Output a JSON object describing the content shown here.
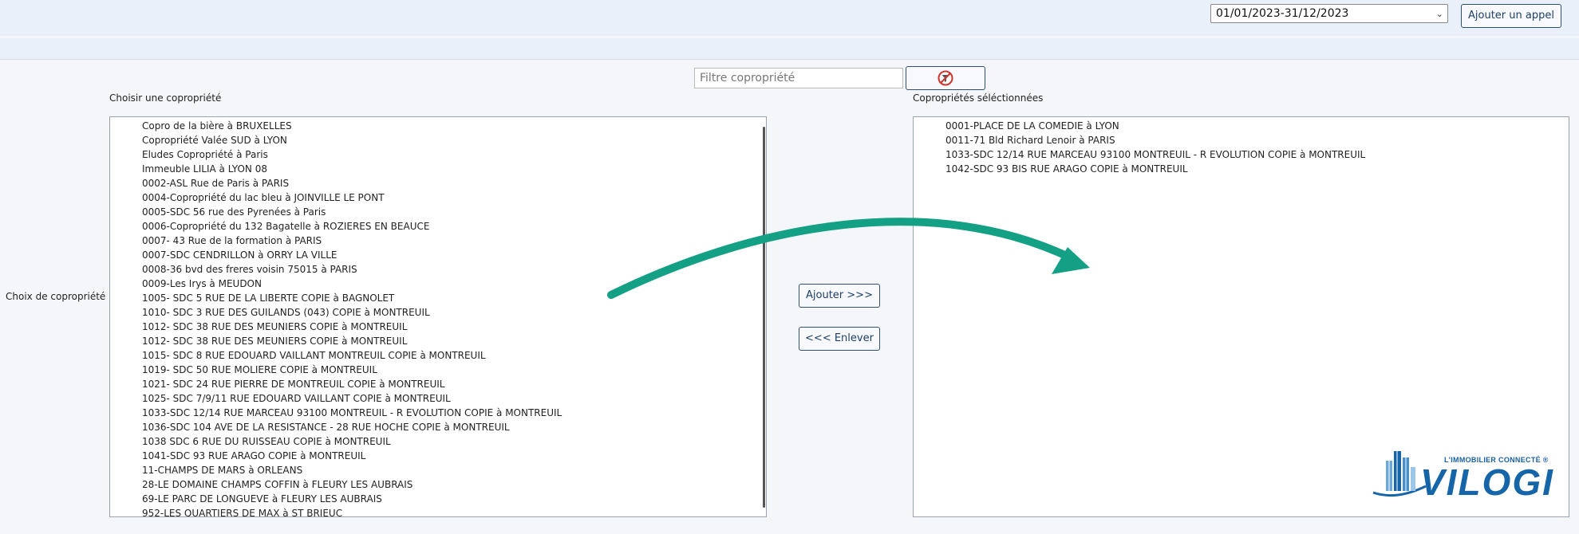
{
  "header": {
    "period_value": "01/01/2023-31/12/2023",
    "add_call_label": "Ajouter un appel"
  },
  "filter": {
    "placeholder": "Filtre copropriété"
  },
  "labels": {
    "choose": "Choisir une copropriété",
    "selected": "Copropriétés séléctionnées",
    "choice": "Choix de copropriété"
  },
  "buttons": {
    "add": "Ajouter >>>",
    "remove": "<<< Enlever"
  },
  "available": [
    "Copro de la bière à BRUXELLES",
    "Copropriété Valée SUD à LYON",
    "Eludes Copropriété à Paris",
    "Immeuble LILIA à LYON 08",
    "0002-ASL Rue de Paris à PARIS",
    "0004-Copropriété du lac bleu à JOINVILLE LE PONT",
    "0005-SDC 56 rue des Pyrenées à Paris",
    "0006-Copropriété du 132 Bagatelle à ROZIERES EN BEAUCE",
    "0007- 43 Rue de la formation à PARIS",
    "0007-SDC CENDRILLON à ORRY LA VILLE",
    "0008-36 bvd des freres voisin 75015 à PARIS",
    "0009-Les Irys à MEUDON",
    "1005- SDC 5 RUE DE LA LIBERTE COPIE à BAGNOLET",
    "1010- SDC 3 RUE DES GUILANDS (043) COPIE à MONTREUIL",
    "1012- SDC 38 RUE DES MEUNIERS COPIE à MONTREUIL",
    "1012- SDC 38 RUE DES MEUNIERS COPIE à MONTREUIL",
    "1015- SDC 8 RUE EDOUARD VAILLANT MONTREUIL COPIE à MONTREUIL",
    "1019- SDC 50 RUE MOLIERE COPIE à MONTREUIL",
    "1021- SDC 24 RUE PIERRE DE MONTREUIL COPIE à MONTREUIL",
    "1025- SDC 7/9/11 RUE EDOUARD VAILLANT COPIE à MONTREUIL",
    "1033-SDC 12/14 RUE MARCEAU 93100 MONTREUIL - R EVOLUTION COPIE à MONTREUIL",
    "1036-SDC 104 AVE DE LA RESISTANCE - 28 RUE HOCHE COPIE à MONTREUIL",
    "1038 SDC 6 RUE DU RUISSEAU COPIE à MONTREUIL",
    "1041-SDC 93 RUE ARAGO COPIE à MONTREUIL",
    "11-CHAMPS DE MARS à ORLEANS",
    "28-LE DOMAINE CHAMPS COFFIN à FLEURY LES AUBRAIS",
    "69-LE PARC DE LONGUEVE à FLEURY LES AUBRAIS",
    "952-LES QUARTIERS DE MAX à ST BRIEUC"
  ],
  "selected": [
    "0001-PLACE DE LA COMEDIE à LYON",
    "0011-71 Bld Richard Lenoir à PARIS",
    "1033-SDC 12/14 RUE MARCEAU 93100 MONTREUIL - R EVOLUTION COPIE à MONTREUIL",
    "1042-SDC 93 BIS RUE ARAGO COPIE à MONTREUIL"
  ],
  "logo": {
    "tagline": "L'IMMOBILIER CONNECTÉ ®",
    "wordmark": "VILOGI"
  },
  "colors": {
    "arrow": "#14a085",
    "brand": "#1565a8"
  },
  "icons": {
    "clear_filter": "clear-filter-icon",
    "dropdown": "chevron-down-icon"
  }
}
